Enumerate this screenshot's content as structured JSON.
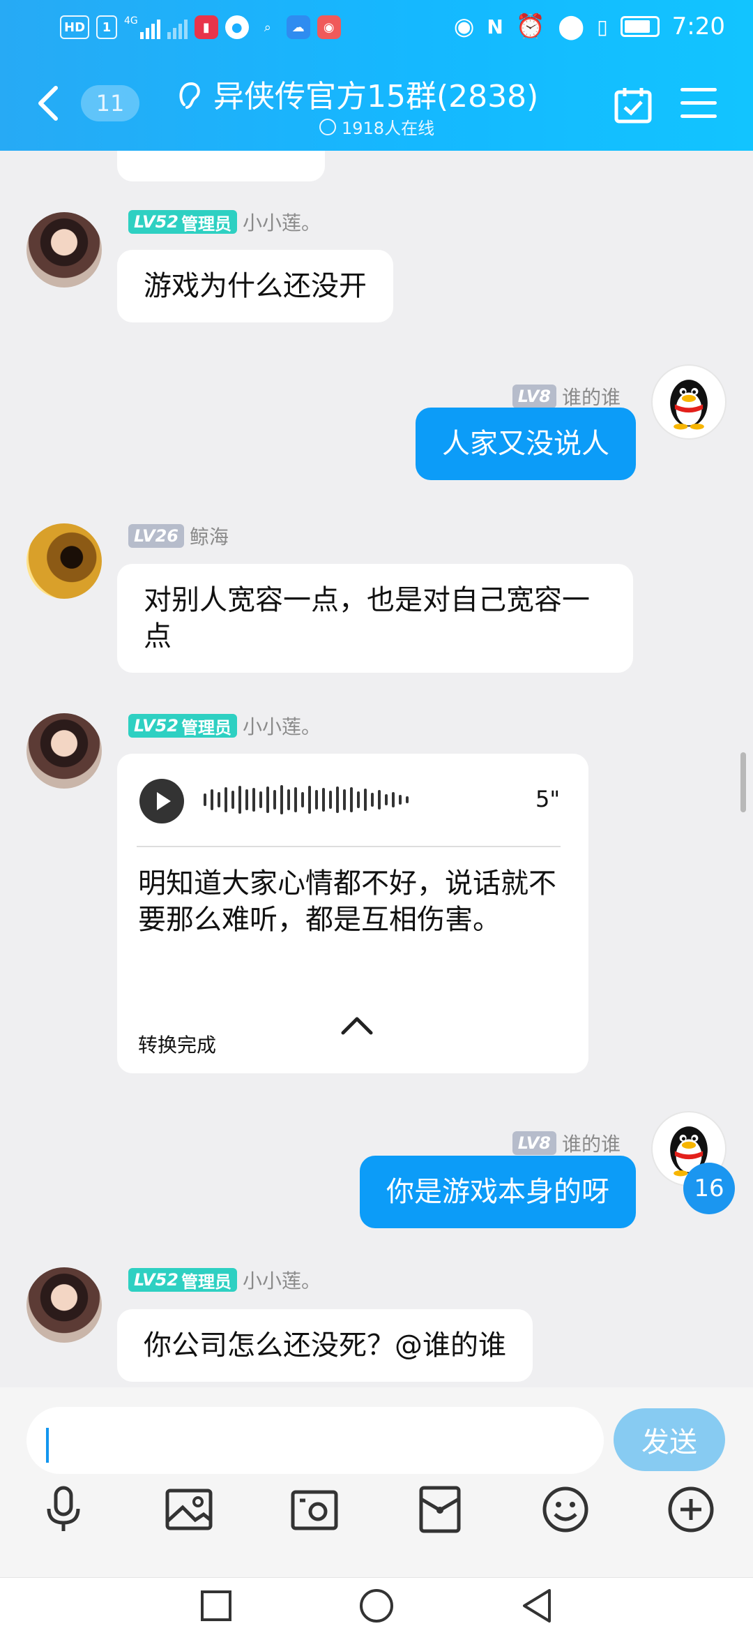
{
  "status_bar": {
    "hd": "HD",
    "sim": "1",
    "network": "4G",
    "time": "7:20",
    "icons": [
      "book-app-icon",
      "message-app-icon",
      "search-app-icon",
      "weather-app-icon",
      "camera-app-icon",
      "eye-icon",
      "nfc-icon",
      "alarm-icon",
      "location-icon",
      "vibrate-icon",
      "battery-icon"
    ]
  },
  "header": {
    "back_count": "11",
    "title": "异侠传官方15群(2838)",
    "online": "1918人在线",
    "gradient": [
      "#27aaf5",
      "#12c4ff"
    ]
  },
  "messages": [
    {
      "sender": "小小莲。",
      "level": "LV52",
      "role": "管理员",
      "text": "游戏为什么还没开",
      "mine": false
    },
    {
      "sender": "谁的谁",
      "level": "LV8",
      "text": "人家又没说人",
      "mine": true
    },
    {
      "sender": "鲸海",
      "level": "LV26",
      "text": "对别人宽容一点，也是对自己宽容一点",
      "mine": false
    },
    {
      "sender": "小小莲。",
      "level": "LV52",
      "role": "管理员",
      "voice": {
        "duration": "5\"",
        "transcript": "明知道大家心情都不好，说话就不要那么难听，都是互相伤害。",
        "status": "转换完成"
      },
      "mine": false
    },
    {
      "sender": "谁的谁",
      "level": "LV8",
      "text": "你是游戏本身的呀",
      "mine": true
    },
    {
      "sender": "小小莲。",
      "level": "LV52",
      "role": "管理员",
      "text": "你公司怎么还没死？@谁的谁",
      "mine": false
    }
  ],
  "unread_badge": "16",
  "input": {
    "placeholder": "",
    "send_label": "发送"
  },
  "colors": {
    "my_bubble": "#0c9cf8",
    "admin_badge": "#2ed0c2",
    "level_badge": "#b6bccb",
    "send_button": "#87cbf2"
  },
  "toolbar": [
    "microphone-icon",
    "image-icon",
    "camera-icon",
    "red-packet-icon",
    "emoji-icon",
    "plus-icon"
  ],
  "nav": [
    "recent-apps-icon",
    "home-icon",
    "back-icon"
  ]
}
